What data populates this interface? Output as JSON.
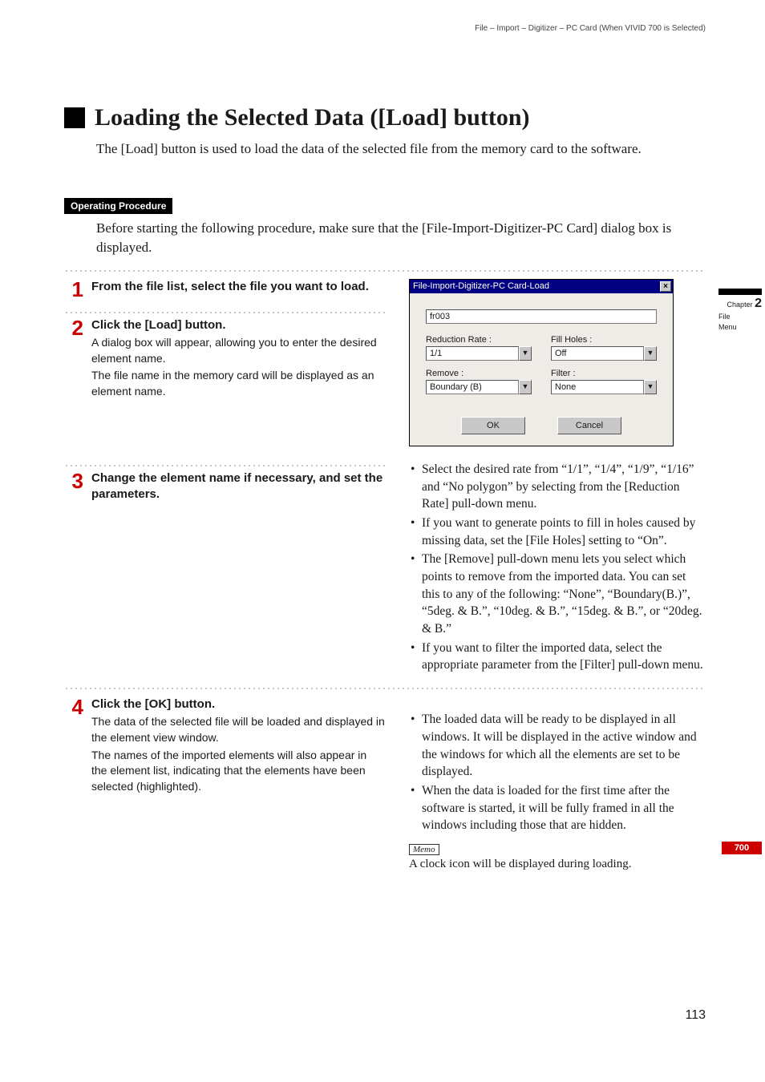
{
  "breadcrumb": "File – Import – Digitizer – PC Card (When VIVID 700 is Selected)",
  "heading": "Loading the Selected Data ([Load] button)",
  "lead": "The [Load] button is used to load the data of the selected file from the memory card to the software.",
  "operating_procedure_label": "Operating Procedure",
  "intro": "Before starting the following procedure, make sure that the [File-Import-Digitizer-PC Card] dialog box is displayed.",
  "steps": {
    "s1": {
      "num": "1",
      "title": "From the file list, select the file you want to load."
    },
    "s2": {
      "num": "2",
      "title": "Click the [Load] button.",
      "body1": "A dialog box will appear, allowing you to enter the desired element name.",
      "body2": "The file name in the memory card will be displayed as an element name."
    },
    "s3": {
      "num": "3",
      "title": "Change the element name if necessary, and set the parameters.",
      "bullets": [
        "Select the desired rate from “1/1”, “1/4”, “1/9”, “1/16” and “No polygon” by selecting from the [Reduction Rate] pull-down menu.",
        "If you want to generate points to fill in holes caused by missing data, set the [File Holes] setting to “On”.",
        "The [Remove] pull-down menu lets you select which points to remove from the imported data. You can set this to any of the following: “None”, “Boundary(B.)”, “5deg. & B.”, “10deg. & B.”, “15deg. & B.”, or “20deg. & B.”",
        "If you want to filter the imported data, select the appropriate parameter from the [Filter] pull-down menu."
      ]
    },
    "s4": {
      "num": "4",
      "title": "Click the [OK] button.",
      "body1": "The data of the selected file will be loaded and displayed in the element view window.",
      "body2": "The names of the imported elements will also appear in the element list, indicating that the elements have been selected (highlighted).",
      "bullets": [
        "The loaded data will be ready to be displayed in all windows. It will be displayed in the active window and the windows for which all the elements are set to be displayed.",
        "When the data is loaded for the first time after the software is started, it will be fully framed in all the windows including those that are hidden."
      ],
      "memo_label": "Memo",
      "memo_text": "A clock icon will be displayed during loading."
    }
  },
  "dialog": {
    "title": "File-Import-Digitizer-PC Card-Load",
    "name_value": "fr003",
    "reduction_label": "Reduction Rate :",
    "reduction_value": "1/1",
    "fillholes_label": "Fill Holes :",
    "fillholes_value": "Off",
    "remove_label": "Remove :",
    "remove_value": "Boundary (B)",
    "filter_label": "Filter :",
    "filter_value": "None",
    "ok": "OK",
    "cancel": "Cancel"
  },
  "side": {
    "chapter_prefix": "Chapter",
    "chapter_num": "2",
    "sub1": "File",
    "sub2": "Menu",
    "badge": "700"
  },
  "page_number": "113"
}
